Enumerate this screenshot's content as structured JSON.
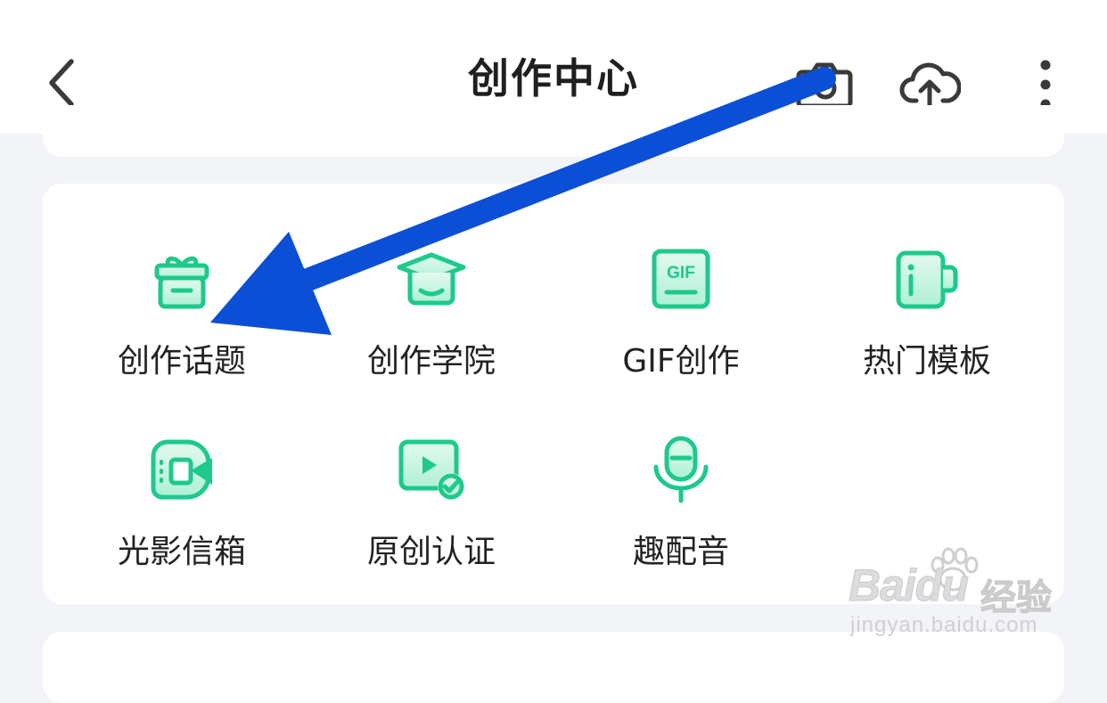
{
  "header": {
    "title": "创作中心",
    "icons": [
      "back-icon",
      "camera-icon",
      "upload-cloud-icon",
      "more-vertical-icon"
    ]
  },
  "grid": {
    "items": [
      {
        "label": "创作话题",
        "icon": "gift-box-icon"
      },
      {
        "label": "创作学院",
        "icon": "graduation-cap-icon"
      },
      {
        "label": "GIF创作",
        "icon": "gif-icon"
      },
      {
        "label": "热门模板",
        "icon": "mug-icon"
      },
      {
        "label": "光影信箱",
        "icon": "video-camera-icon"
      },
      {
        "label": "原创认证",
        "icon": "video-verified-icon"
      },
      {
        "label": "趣配音",
        "icon": "microphone-icon"
      }
    ],
    "gif_text": "GIF"
  },
  "watermark": {
    "brand": "Baidu",
    "brand2": "经验",
    "url": "jingyan.baidu.com"
  },
  "colors": {
    "accent_green": "#1ec98b",
    "accent_green_light": "#c8f3e3",
    "annotation_arrow": "#0a4fd6",
    "page_bg": "#f3f4f8",
    "card_bg": "#ffffff"
  }
}
